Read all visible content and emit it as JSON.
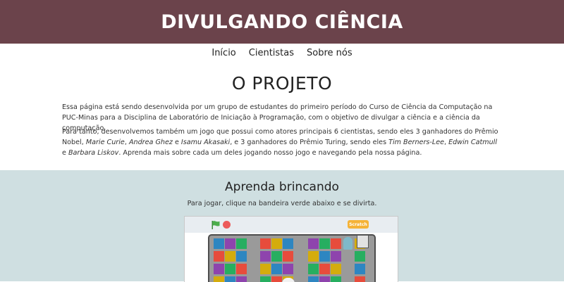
{
  "header": {
    "title": "DIVULGANDO CIÊNCIA"
  },
  "nav": {
    "items": [
      "Início",
      "Cientistas",
      "Sobre nós"
    ]
  },
  "project": {
    "title": "O PROJETO",
    "paragraph1": "Essa página está sendo desenvolvida por um grupo de estudantes do primeiro período do Curso de Ciência da Computação na PUC-Minas para a Disciplina de Laboratório de Iniciação à Programação, com o objetivo de divulgar a ciência e a ciência da computação.",
    "paragraph2": {
      "intro": "Para tanto, desenvolvemos também um jogo que possui como atores principais 6 cientistas, sendo eles 3 ganhadores do Prêmio Nobel, ",
      "nobel_1": "Marie Curie",
      "sep1": ", ",
      "nobel_2": "Andrea Ghez",
      "sep2": " e ",
      "nobel_3": "Isamu Akasaki",
      "middle": ", e 3 ganhadores do Prêmio Turing, sendo eles ",
      "turing_1": "Tim Berners-Lee",
      "sep3": ", ",
      "turing_2": "Edwin Catmull",
      "sep4": " e ",
      "turing_3": "Barbara Liskov",
      "outro": ". Aprenda mais sobre cada um deles jogando nosso jogo e navegando pela nossa página."
    }
  },
  "game_section": {
    "title": "Aprenda brincando",
    "instruction": "Para jogar, clique na bandeira verde abaixo e se divirta.",
    "logo_text": "Scratch"
  },
  "colors": {
    "header_bg": "#6b434b",
    "section_bg": "#cfdfe1",
    "flag": "#4cae4c",
    "stop": "#ec5a5a",
    "tiles": [
      "#2e86c1",
      "#d4ac0d",
      "#e74c3c",
      "#27ae60",
      "#8e44ad"
    ]
  },
  "icons": {
    "flag": "green-flag-icon",
    "stop": "stop-icon",
    "logo": "scratch-logo"
  }
}
